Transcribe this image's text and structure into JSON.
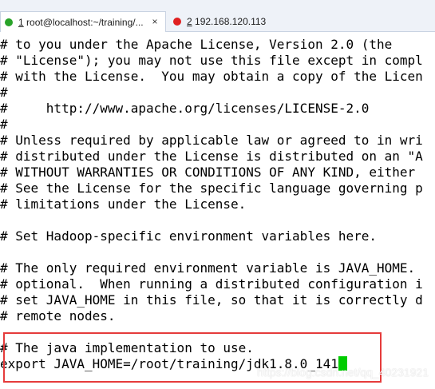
{
  "tabs": [
    {
      "num": "1",
      "label": " root@localhost:~/training/...",
      "status_color": "#29a329",
      "active": true
    },
    {
      "num": "2",
      "label": " 192.168.120.113",
      "status_color": "#e02020",
      "active": false
    }
  ],
  "close_glyph": "×",
  "terminal": {
    "lines": [
      "# to you under the Apache License, Version 2.0 (the",
      "# \"License\"); you may not use this file except in compl",
      "# with the License.  You may obtain a copy of the Licen",
      "#",
      "#     http://www.apache.org/licenses/LICENSE-2.0",
      "#",
      "# Unless required by applicable law or agreed to in wri",
      "# distributed under the License is distributed on an \"A",
      "# WITHOUT WARRANTIES OR CONDITIONS OF ANY KIND, either",
      "# See the License for the specific language governing p",
      "# limitations under the License.",
      "",
      "# Set Hadoop-specific environment variables here.",
      "",
      "# The only required environment variable is JAVA_HOME.",
      "# optional.  When running a distributed configuration i",
      "# set JAVA_HOME in this file, so that it is correctly d",
      "# remote nodes.",
      "",
      "# The java implementation to use.",
      "export JAVA_HOME=/root/training/jdk1.8.0_141"
    ],
    "cursor_color": "#00cc00"
  },
  "watermark": "https://blog.csdn.net/qq_40231921"
}
